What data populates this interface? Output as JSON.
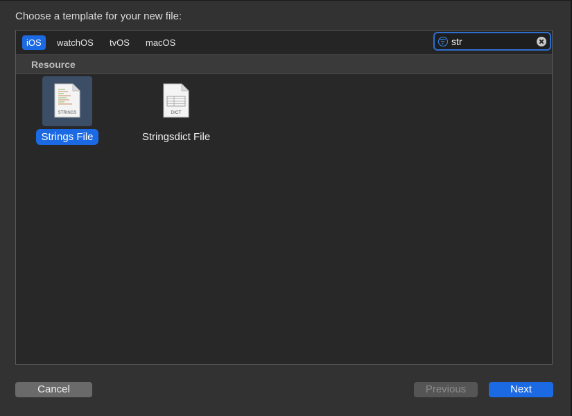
{
  "prompt": "Choose a template for your new file:",
  "platform_tabs": [
    {
      "label": "iOS",
      "active": true
    },
    {
      "label": "watchOS",
      "active": false
    },
    {
      "label": "tvOS",
      "active": false
    },
    {
      "label": "macOS",
      "active": false
    }
  ],
  "search": {
    "value": "str",
    "icon": "filter-icon",
    "clear_icon": "clear-icon"
  },
  "section": {
    "title": "Resource"
  },
  "templates": [
    {
      "label": "Strings File",
      "icon_text": "STRINGS",
      "icon": "strings-file-icon",
      "selected": true
    },
    {
      "label": "Stringsdict File",
      "icon_text": "DICT",
      "icon": "stringsdict-file-icon",
      "selected": false
    }
  ],
  "buttons": {
    "cancel": "Cancel",
    "previous": "Previous",
    "next": "Next"
  },
  "colors": {
    "accent": "#1c6ae3",
    "background": "#323232",
    "panel": "#282828"
  }
}
